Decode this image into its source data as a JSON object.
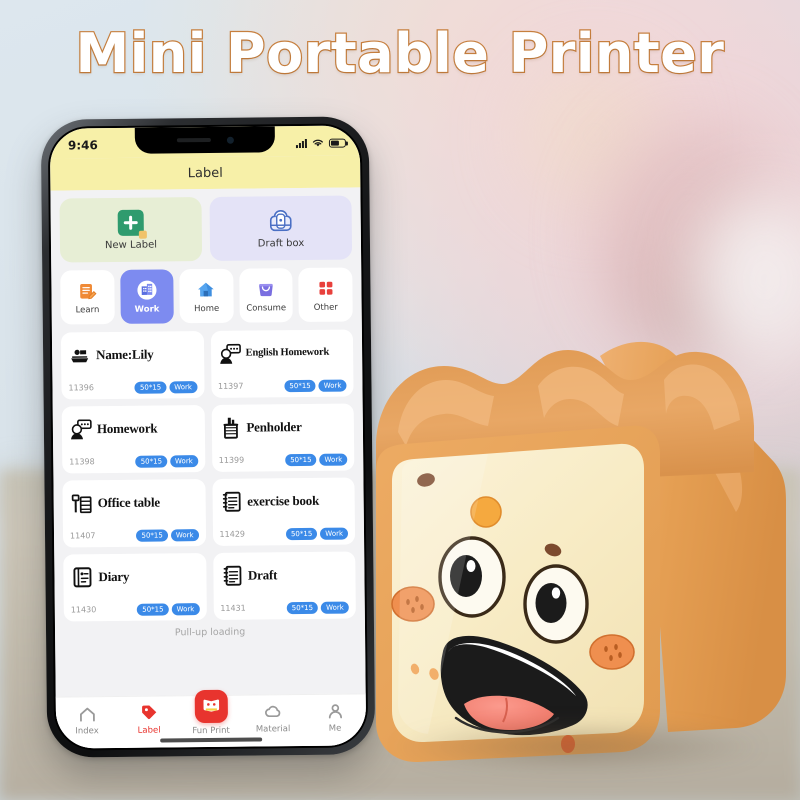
{
  "headline": "Mini Portable Printer",
  "colors": {
    "title_fill": "#ffffff",
    "title_stroke": "#c8803f",
    "background": "#dbe5ec",
    "header_yellow": "#f7f0a8",
    "accent_blue": "#3b8ae8",
    "active_category": "#7d8bf0",
    "brand_red": "#e8342e",
    "new_label_card": "#e7eed5",
    "draft_box_card": "#e4e3f7",
    "printer_crust": "#e8a155",
    "printer_face": "#f7e9c0"
  },
  "phone": {
    "status_bar": {
      "time": "9:46",
      "icons": [
        "signal-icon",
        "wifi-icon",
        "battery-icon"
      ]
    },
    "app_header": {
      "title": "Label"
    },
    "quick_actions": [
      {
        "label": "New Label",
        "icon": "new-label-plus-icon"
      },
      {
        "label": "Draft box",
        "icon": "draft-box-icon"
      }
    ],
    "categories": [
      {
        "label": "Learn",
        "icon": "learn-note-icon",
        "active": false
      },
      {
        "label": "Work",
        "icon": "work-building-icon",
        "active": true
      },
      {
        "label": "Home",
        "icon": "home-house-icon",
        "active": false
      },
      {
        "label": "Consume",
        "icon": "consume-bag-icon",
        "active": false
      },
      {
        "label": "Other",
        "icon": "other-grid-icon",
        "active": false
      }
    ],
    "templates": [
      {
        "title": "Name:Lily",
        "id": "11396",
        "size": "50*15",
        "tag": "Work",
        "icon": "boat-banner-icon",
        "two_line": false
      },
      {
        "title": "English Homework",
        "id": "11397",
        "size": "50*15",
        "tag": "Work",
        "icon": "speech-person-icon",
        "two_line": true
      },
      {
        "title": "Homework",
        "id": "11398",
        "size": "50*15",
        "tag": "Work",
        "icon": "speech-person-icon",
        "two_line": false
      },
      {
        "title": "Penholder",
        "id": "11399",
        "size": "50*15",
        "tag": "Work",
        "icon": "penholder-icon",
        "two_line": false
      },
      {
        "title": "Office table",
        "id": "11407",
        "size": "50*15",
        "tag": "Work",
        "icon": "office-desk-icon",
        "two_line": false
      },
      {
        "title": "exercise book",
        "id": "11429",
        "size": "50*15",
        "tag": "Work",
        "icon": "notebook-icon",
        "two_line": false
      },
      {
        "title": "Diary",
        "id": "11430",
        "size": "50*15",
        "tag": "Work",
        "icon": "diary-icon",
        "two_line": false
      },
      {
        "title": "Draft",
        "id": "11431",
        "size": "50*15",
        "tag": "Work",
        "icon": "notebook-icon",
        "two_line": false
      }
    ],
    "loading_hint": "Pull-up loading",
    "tabs": [
      {
        "label": "Index",
        "icon": "home-outline-icon",
        "active": false
      },
      {
        "label": "Label",
        "icon": "tag-icon",
        "active": true
      },
      {
        "label": "Fun Print",
        "icon": "funprint-logo-icon",
        "active": false
      },
      {
        "label": "Material",
        "icon": "cloud-icon",
        "active": false
      },
      {
        "label": "Me",
        "icon": "person-icon",
        "active": false
      }
    ]
  },
  "product": {
    "name": "toast-shaped-mini-printer",
    "face": "smiling-bread-face"
  }
}
